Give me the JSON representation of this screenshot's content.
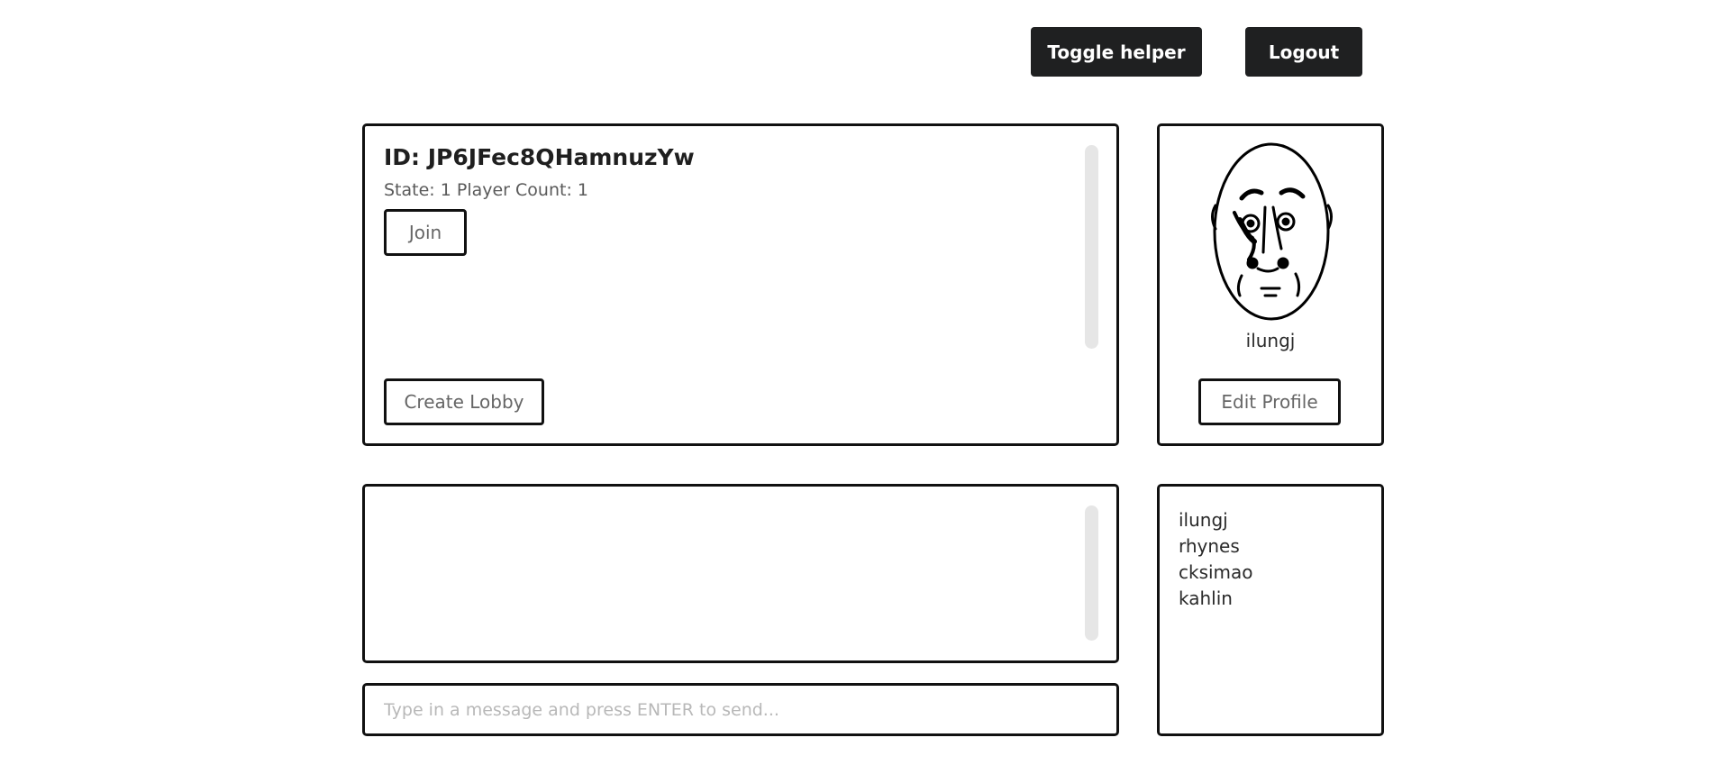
{
  "header": {
    "toggle_helper_label": "Toggle helper",
    "logout_label": "Logout"
  },
  "lobby_panel": {
    "lobbies": [
      {
        "id_text": "ID: JP6JFec8QHamnuzYw",
        "meta_text": "State: 1 Player Count: 1",
        "join_label": "Join"
      }
    ],
    "create_lobby_label": "Create Lobby"
  },
  "profile": {
    "avatar_icon": "face-avatar-icon",
    "username": "ilungj",
    "edit_profile_label": "Edit Profile"
  },
  "chat": {
    "input_placeholder": "Type in a message and press ENTER to send...",
    "input_value": ""
  },
  "online_users": [
    "ilungj",
    "rhynes",
    "cksimao",
    "kahlin"
  ],
  "colors": {
    "dark_button": "#1f2021",
    "border": "#111111",
    "scroll_track": "#e6e6e6"
  }
}
